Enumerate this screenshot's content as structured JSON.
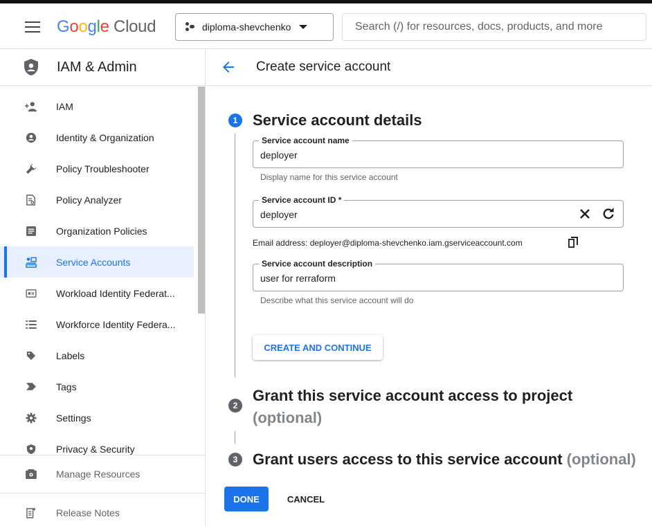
{
  "header": {
    "logo_google": "Google",
    "logo_cloud": "Cloud",
    "project": "diploma-shevchenko",
    "search_placeholder": "Search (/) for resources, docs, products, and more"
  },
  "sidebar": {
    "title": "IAM & Admin",
    "items": [
      {
        "label": "IAM",
        "icon": "person-add-icon"
      },
      {
        "label": "Identity & Organization",
        "icon": "account-circle-icon"
      },
      {
        "label": "Policy Troubleshooter",
        "icon": "wrench-icon"
      },
      {
        "label": "Policy Analyzer",
        "icon": "document-search-icon"
      },
      {
        "label": "Organization Policies",
        "icon": "article-icon"
      },
      {
        "label": "Service Accounts",
        "icon": "service-account-icon",
        "active": true
      },
      {
        "label": "Workload Identity Federat...",
        "icon": "badge-icon"
      },
      {
        "label": "Workforce Identity Federa...",
        "icon": "list-icon"
      },
      {
        "label": "Labels",
        "icon": "label-icon"
      },
      {
        "label": "Tags",
        "icon": "tag-icon"
      },
      {
        "label": "Settings",
        "icon": "gear-icon"
      },
      {
        "label": "Privacy & Security",
        "icon": "shield-icon"
      }
    ],
    "bottom": [
      {
        "label": "Manage Resources",
        "icon": "manage-resources-icon"
      },
      {
        "label": "Release Notes",
        "icon": "release-notes-icon"
      }
    ]
  },
  "main": {
    "title": "Create service account",
    "step1": {
      "num": "1",
      "title": "Service account details",
      "name_label": "Service account name",
      "name_value": "deployer",
      "name_hint": "Display name for this service account",
      "id_label": "Service account ID *",
      "id_value": "deployer",
      "email": "Email address: deployer@diploma-shevchenko.iam.gserviceaccount.com",
      "desc_label": "Service account description",
      "desc_value": "user for rerraform",
      "desc_hint": "Describe what this service account will do",
      "create_button": "CREATE AND CONTINUE"
    },
    "step2": {
      "num": "2",
      "title": "Grant this service account access to project",
      "optional": "(optional)"
    },
    "step3": {
      "num": "3",
      "title": "Grant users access to this service account",
      "optional": "(optional)"
    },
    "done_button": "DONE",
    "cancel_button": "CANCEL"
  },
  "colors": {
    "accent": "#1a73e8",
    "active_bg": "#e8f0fe"
  }
}
